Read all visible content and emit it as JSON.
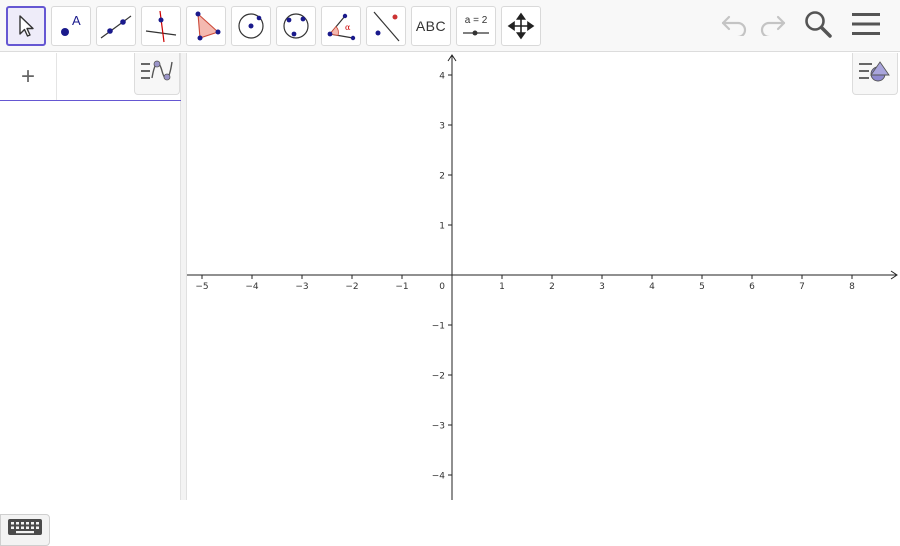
{
  "toolbar": {
    "tools": [
      {
        "id": "move",
        "icon": "arrow-cursor-icon"
      },
      {
        "id": "point",
        "icon": "point-icon",
        "label": "A"
      },
      {
        "id": "line",
        "icon": "line-through-points-icon"
      },
      {
        "id": "perpendicular",
        "icon": "perpendicular-line-icon"
      },
      {
        "id": "polygon",
        "icon": "polygon-icon"
      },
      {
        "id": "circle-center",
        "icon": "circle-center-point-icon"
      },
      {
        "id": "circle-three-points",
        "icon": "circle-three-points-icon"
      },
      {
        "id": "angle",
        "icon": "angle-icon",
        "label": "α"
      },
      {
        "id": "reflect",
        "icon": "reflect-about-line-icon"
      },
      {
        "id": "text",
        "icon": "text-icon",
        "label": "ABC"
      },
      {
        "id": "slider",
        "icon": "slider-icon",
        "label": "a = 2"
      },
      {
        "id": "move-graphics",
        "icon": "move-graphics-view-icon"
      }
    ],
    "undo_icon": "undo-icon",
    "redo_icon": "redo-icon",
    "search_icon": "search-icon",
    "menu_icon": "hamburger-menu-icon"
  },
  "algebra": {
    "input_button": "+",
    "style_icon": "algebra-style-icon",
    "keyboard_icon": "keyboard-icon"
  },
  "graphics": {
    "style_icon": "graphics-style-icon",
    "x_ticks": [
      "−5",
      "−4",
      "−3",
      "−2",
      "−1",
      "1",
      "2",
      "3",
      "4",
      "5",
      "6",
      "7",
      "8"
    ],
    "y_ticks": [
      "4",
      "3",
      "2",
      "1",
      "−1",
      "−2",
      "−3",
      "−4"
    ],
    "origin_label": "0"
  },
  "colors": {
    "accent": "#6557d2",
    "point": "#1a1a8c",
    "polygon_fill": "#f4b9b0",
    "red": "#cc0000"
  }
}
